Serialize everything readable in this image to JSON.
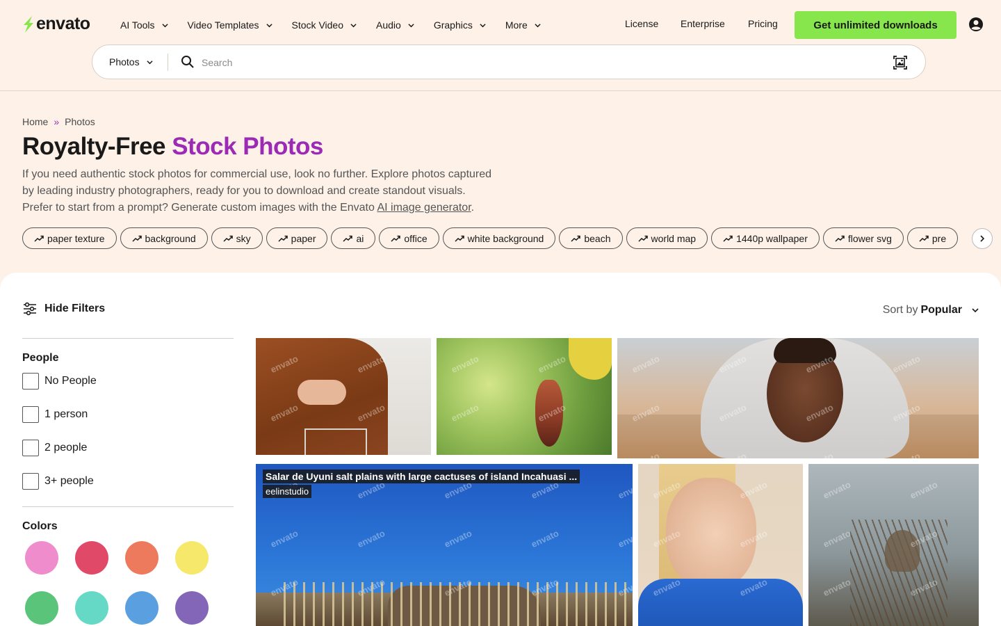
{
  "header": {
    "logo": "envato",
    "nav": [
      {
        "label": "AI Tools"
      },
      {
        "label": "Video Templates"
      },
      {
        "label": "Stock Video"
      },
      {
        "label": "Audio"
      },
      {
        "label": "Graphics"
      },
      {
        "label": "More"
      }
    ],
    "links": {
      "license": "License",
      "enterprise": "Enterprise",
      "pricing": "Pricing"
    },
    "cta": "Get unlimited downloads"
  },
  "search": {
    "category": "Photos",
    "placeholder": "Search"
  },
  "breadcrumb": {
    "home": "Home",
    "separator": "»",
    "current": "Photos"
  },
  "hero": {
    "title_plain": "Royalty-Free ",
    "title_accent": "Stock Photos",
    "desc_line1": "If you need authentic stock photos for commercial use, look no further. Explore photos captured",
    "desc_line2": "by leading industry photographers, ready for you to download and create standout visuals.",
    "desc_line3_pre": "Prefer to start from a prompt? Generate custom images with the Envato ",
    "desc_link": "AI image generator",
    "desc_line3_post": "."
  },
  "tags": [
    "paper texture",
    "background",
    "sky",
    "paper",
    "ai",
    "office",
    "white background",
    "beach",
    "world map",
    "1440p wallpaper",
    "flower svg",
    "pre"
  ],
  "filters": {
    "toggle_label": "Hide Filters",
    "people_title": "People",
    "people_options": [
      "No People",
      "1 person",
      "2 people",
      "3+ people"
    ],
    "colors_title": "Colors",
    "colors": [
      "#ee8ccc",
      "#e04a68",
      "#ee7a5e",
      "#f5e86a",
      "#5ac47a",
      "#66d9c6",
      "#5aa0e0",
      "#8466b8"
    ]
  },
  "sort": {
    "prefix": "Sort by",
    "value": "Popular"
  },
  "watermark": "envato",
  "featured_photo": {
    "title": "Salar de Uyuni salt plains with large cactuses of island Incahuasi ...",
    "author": "eelinstudio"
  }
}
